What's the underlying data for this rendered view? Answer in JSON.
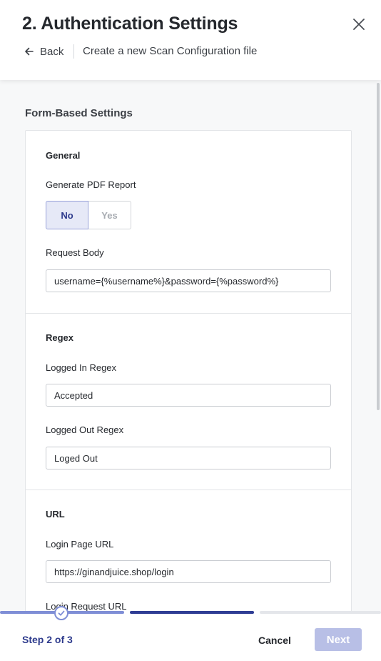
{
  "header": {
    "title": "2. Authentication Settings",
    "back_label": "Back",
    "subtitle": "Create a new Scan Configuration file",
    "close_icon": "close-icon",
    "back_icon": "arrow-left-icon"
  },
  "form": {
    "section_title": "Form-Based Settings",
    "general": {
      "heading": "General",
      "pdf_label": "Generate PDF Report",
      "pdf_options": [
        "No",
        "Yes"
      ],
      "pdf_selected": "No",
      "request_body_label": "Request Body",
      "request_body_value": "username={%username%}&password={%password%}"
    },
    "regex": {
      "heading": "Regex",
      "logged_in_label": "Logged In Regex",
      "logged_in_value": "Accepted",
      "logged_out_label": "Logged Out Regex",
      "logged_out_value": "Loged Out"
    },
    "url": {
      "heading": "URL",
      "login_page_label": "Login Page URL",
      "login_page_value": "https://ginandjuice.shop/login",
      "login_request_label": "Login Request URL"
    }
  },
  "footer": {
    "step_label": "Step 2 of 3",
    "current_step": 2,
    "total_steps": 3,
    "cancel_label": "Cancel",
    "next_label": "Next"
  },
  "colors": {
    "accent": "#2d3a8c",
    "progress_done": "#7f8ed6",
    "progress_active": "#2f3d94",
    "progress_todo": "#e4e6ea",
    "next_disabled": "#b8bfe6"
  }
}
